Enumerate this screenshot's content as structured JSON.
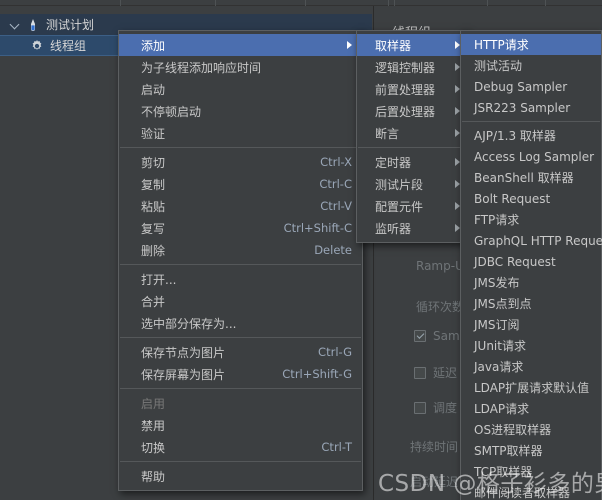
{
  "tree": {
    "items": [
      {
        "label": "测试计划",
        "icon": "test-plan-icon"
      },
      {
        "label": "线程组",
        "icon": "gear-icon"
      }
    ]
  },
  "right_pane": {
    "title": "线程组",
    "fields": [
      {
        "label": "Ramp-U",
        "name": "ramp-up-label"
      },
      {
        "label": "循环次数",
        "name": "loop-count-label"
      },
      {
        "label": "持续时间",
        "name": "duration-label"
      },
      {
        "label": "启动延迟",
        "name": "startup-delay-label"
      }
    ],
    "checkboxes": [
      {
        "label": "Sam",
        "checked": true,
        "name": "same-user-checkbox"
      },
      {
        "label": "延迟",
        "checked": false,
        "name": "delay-checkbox"
      },
      {
        "label": "调度",
        "checked": false,
        "name": "scheduler-checkbox"
      }
    ]
  },
  "menu_main": {
    "items": [
      {
        "label": "添加",
        "accel": "",
        "submenu": true,
        "selected": true,
        "disabled": false,
        "sep_after": false
      },
      {
        "label": "为子线程添加响应时间",
        "accel": "",
        "submenu": false,
        "selected": false,
        "disabled": false,
        "sep_after": false
      },
      {
        "label": "启动",
        "accel": "",
        "submenu": false,
        "selected": false,
        "disabled": false,
        "sep_after": false
      },
      {
        "label": "不停顿启动",
        "accel": "",
        "submenu": false,
        "selected": false,
        "disabled": false,
        "sep_after": false
      },
      {
        "label": "验证",
        "accel": "",
        "submenu": false,
        "selected": false,
        "disabled": false,
        "sep_after": true
      },
      {
        "label": "剪切",
        "accel": "Ctrl-X",
        "submenu": false,
        "selected": false,
        "disabled": false,
        "sep_after": false
      },
      {
        "label": "复制",
        "accel": "Ctrl-C",
        "submenu": false,
        "selected": false,
        "disabled": false,
        "sep_after": false
      },
      {
        "label": "粘贴",
        "accel": "Ctrl-V",
        "submenu": false,
        "selected": false,
        "disabled": false,
        "sep_after": false
      },
      {
        "label": "复写",
        "accel": "Ctrl+Shift-C",
        "submenu": false,
        "selected": false,
        "disabled": false,
        "sep_after": false
      },
      {
        "label": "删除",
        "accel": "Delete",
        "submenu": false,
        "selected": false,
        "disabled": false,
        "sep_after": true
      },
      {
        "label": "打开...",
        "accel": "",
        "submenu": false,
        "selected": false,
        "disabled": false,
        "sep_after": false
      },
      {
        "label": "合并",
        "accel": "",
        "submenu": false,
        "selected": false,
        "disabled": false,
        "sep_after": false
      },
      {
        "label": "选中部分保存为...",
        "accel": "",
        "submenu": false,
        "selected": false,
        "disabled": false,
        "sep_after": true
      },
      {
        "label": "保存节点为图片",
        "accel": "Ctrl-G",
        "submenu": false,
        "selected": false,
        "disabled": false,
        "sep_after": false
      },
      {
        "label": "保存屏幕为图片",
        "accel": "Ctrl+Shift-G",
        "submenu": false,
        "selected": false,
        "disabled": false,
        "sep_after": true
      },
      {
        "label": "启用",
        "accel": "",
        "submenu": false,
        "selected": false,
        "disabled": true,
        "sep_after": false
      },
      {
        "label": "禁用",
        "accel": "",
        "submenu": false,
        "selected": false,
        "disabled": false,
        "sep_after": false
      },
      {
        "label": "切换",
        "accel": "Ctrl-T",
        "submenu": false,
        "selected": false,
        "disabled": false,
        "sep_after": true
      },
      {
        "label": "帮助",
        "accel": "",
        "submenu": false,
        "selected": false,
        "disabled": false,
        "sep_after": false
      }
    ]
  },
  "menu_add": {
    "items": [
      {
        "label": "取样器",
        "submenu": true,
        "selected": true,
        "sep_after": false
      },
      {
        "label": "逻辑控制器",
        "submenu": true,
        "selected": false,
        "sep_after": false
      },
      {
        "label": "前置处理器",
        "submenu": true,
        "selected": false,
        "sep_after": false
      },
      {
        "label": "后置处理器",
        "submenu": true,
        "selected": false,
        "sep_after": false
      },
      {
        "label": "断言",
        "submenu": true,
        "selected": false,
        "sep_after": true
      },
      {
        "label": "定时器",
        "submenu": true,
        "selected": false,
        "sep_after": false
      },
      {
        "label": "测试片段",
        "submenu": true,
        "selected": false,
        "sep_after": false
      },
      {
        "label": "配置元件",
        "submenu": true,
        "selected": false,
        "sep_after": false
      },
      {
        "label": "监听器",
        "submenu": true,
        "selected": false,
        "sep_after": false
      }
    ]
  },
  "menu_sampler": {
    "items": [
      {
        "label": "HTTP请求",
        "selected": true,
        "sep_after": false
      },
      {
        "label": "测试活动",
        "selected": false,
        "sep_after": false
      },
      {
        "label": "Debug Sampler",
        "selected": false,
        "sep_after": false
      },
      {
        "label": "JSR223 Sampler",
        "selected": false,
        "sep_after": true
      },
      {
        "label": "AJP/1.3 取样器",
        "selected": false,
        "sep_after": false
      },
      {
        "label": "Access Log Sampler",
        "selected": false,
        "sep_after": false
      },
      {
        "label": "BeanShell 取样器",
        "selected": false,
        "sep_after": false
      },
      {
        "label": "Bolt Request",
        "selected": false,
        "sep_after": false
      },
      {
        "label": "FTP请求",
        "selected": false,
        "sep_after": false
      },
      {
        "label": "GraphQL HTTP Request",
        "selected": false,
        "sep_after": false
      },
      {
        "label": "JDBC Request",
        "selected": false,
        "sep_after": false
      },
      {
        "label": "JMS发布",
        "selected": false,
        "sep_after": false
      },
      {
        "label": "JMS点到点",
        "selected": false,
        "sep_after": false
      },
      {
        "label": "JMS订阅",
        "selected": false,
        "sep_after": false
      },
      {
        "label": "JUnit请求",
        "selected": false,
        "sep_after": false
      },
      {
        "label": "Java请求",
        "selected": false,
        "sep_after": false
      },
      {
        "label": "LDAP扩展请求默认值",
        "selected": false,
        "sep_after": false
      },
      {
        "label": "LDAP请求",
        "selected": false,
        "sep_after": false
      },
      {
        "label": "OS进程取样器",
        "selected": false,
        "sep_after": false
      },
      {
        "label": "SMTP取样器",
        "selected": false,
        "sep_after": false
      },
      {
        "label": "TCP取样器",
        "selected": false,
        "sep_after": false
      },
      {
        "label": "邮件阅读者取样器",
        "selected": false,
        "sep_after": false
      }
    ]
  },
  "watermark": {
    "text": "CSDN @格子衫多的男孩"
  },
  "colors": {
    "background": "#3c3f41",
    "menu_background": "#3c3f41",
    "menu_border": "#5c5f61",
    "highlight": "#4b6eaf",
    "text": "#c8c8c8",
    "accel_text": "#9aa7b8",
    "disabled_text": "#787878",
    "tree_selected": "#2d4a6b"
  }
}
